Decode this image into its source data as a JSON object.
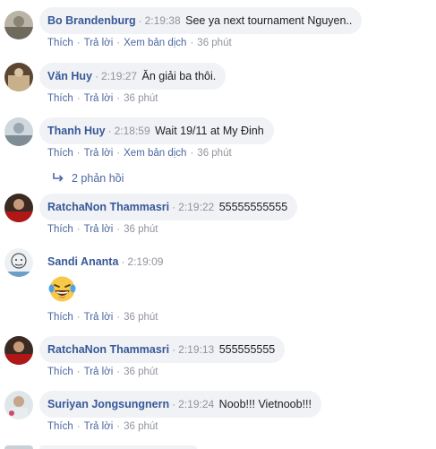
{
  "actions": {
    "like": "Thích",
    "reply": "Trả lời",
    "translate": "Xem bản dịch",
    "time_ago": "36 phút",
    "dot": "·"
  },
  "comments": [
    {
      "author": "Bo Brandenburg",
      "time": "2:19:38",
      "text": "See ya next tournament Nguyen..",
      "show_translate": true
    },
    {
      "author": "Văn Huy",
      "time": "2:19:27",
      "text": "Ăn giải ba thôi.",
      "show_translate": false
    },
    {
      "author": "Thanh Huy",
      "time": "2:18:59",
      "text": "Wait 19/11 at My Đinh",
      "show_translate": true,
      "replies": "2 phản hồi"
    },
    {
      "author": "RatchaNon Thammasri",
      "time": "2:19:22",
      "text": "55555555555",
      "show_translate": false
    },
    {
      "author": "Sandi Ananta",
      "time": "2:19:09",
      "text": "",
      "emoji": "laughing-tears",
      "show_translate": false
    },
    {
      "author": "RatchaNon Thammasri",
      "time": "2:19:13",
      "text": "555555555",
      "show_translate": false
    },
    {
      "author": "Suriyan Jongsungnern",
      "time": "2:19:24",
      "text": "Noob!!! Vietnoob!!!",
      "show_translate": false
    }
  ],
  "colors": {
    "author_link": "#385898",
    "action_link": "#4b67a1",
    "bubble_bg": "#f0f2f5",
    "meta_gray": "#90949c"
  }
}
